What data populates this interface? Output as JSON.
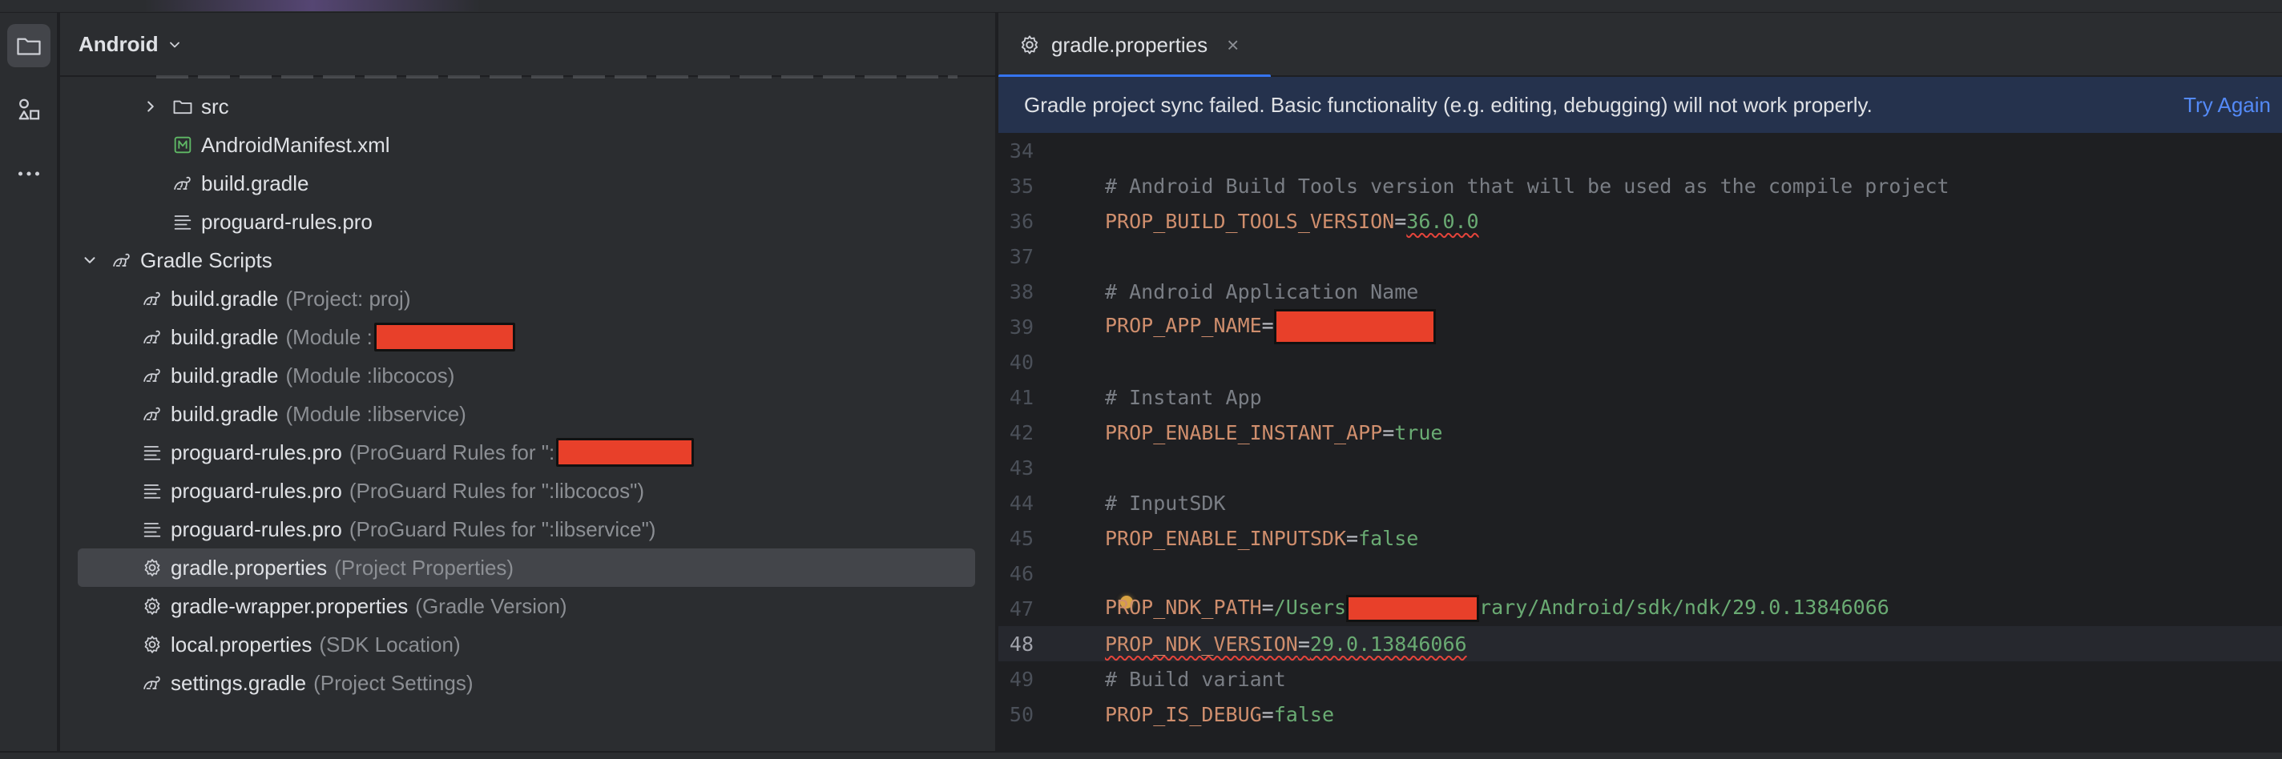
{
  "project_panel": {
    "title": "Android",
    "tree": [
      {
        "label": "src",
        "hint": "",
        "icon": "folder-icon"
      },
      {
        "label": "AndroidManifest.xml",
        "hint": "",
        "icon": "manifest-icon"
      },
      {
        "label": "build.gradle",
        "hint": "",
        "icon": "gradle-icon"
      },
      {
        "label": "proguard-rules.pro",
        "hint": "",
        "icon": "text-file-icon"
      },
      {
        "label": "Gradle Scripts",
        "hint": "",
        "icon": "gradle-icon"
      },
      {
        "label": "build.gradle",
        "hint": "(Project: proj)",
        "icon": "gradle-icon"
      },
      {
        "label": "build.gradle",
        "hint": "(Module :",
        "icon": "gradle-icon"
      },
      {
        "label": "build.gradle",
        "hint": "(Module :libcocos)",
        "icon": "gradle-icon"
      },
      {
        "label": "build.gradle",
        "hint": "(Module :libservice)",
        "icon": "gradle-icon"
      },
      {
        "label": "proguard-rules.pro",
        "hint": "(ProGuard Rules for \":",
        "icon": "text-file-icon"
      },
      {
        "label": "proguard-rules.pro",
        "hint": "(ProGuard Rules for \":libcocos\")",
        "icon": "text-file-icon"
      },
      {
        "label": "proguard-rules.pro",
        "hint": "(ProGuard Rules for \":libservice\")",
        "icon": "text-file-icon"
      },
      {
        "label": "gradle.properties",
        "hint": "(Project Properties)",
        "icon": "gear-icon"
      },
      {
        "label": "gradle-wrapper.properties",
        "hint": "(Gradle Version)",
        "icon": "gear-icon"
      },
      {
        "label": "local.properties",
        "hint": "(SDK Location)",
        "icon": "gear-icon"
      },
      {
        "label": "settings.gradle",
        "hint": "(Project Settings)",
        "icon": "gradle-icon"
      }
    ]
  },
  "editor": {
    "tab": {
      "label": "gradle.properties",
      "close": "×"
    },
    "banner": {
      "message": "Gradle project sync failed. Basic functionality (e.g. editing, debugging) will not work properly.",
      "action": "Try Again"
    },
    "lines": [
      {
        "num": "34",
        "comment": "",
        "key": "",
        "eq": "",
        "value": ""
      },
      {
        "num": "35",
        "comment": "# Android Build Tools version that will be used as the compile project",
        "key": "",
        "eq": "",
        "value": ""
      },
      {
        "num": "36",
        "comment": "",
        "key": "PROP_BUILD_TOOLS_VERSION",
        "eq": "=",
        "value": "36.0.0"
      },
      {
        "num": "37",
        "comment": "",
        "key": "",
        "eq": "",
        "value": ""
      },
      {
        "num": "38",
        "comment": "# Android Application Name",
        "key": "",
        "eq": "",
        "value": ""
      },
      {
        "num": "39",
        "comment": "",
        "key": "PROP_APP_NAME",
        "eq": "=",
        "value": ""
      },
      {
        "num": "40",
        "comment": "",
        "key": "",
        "eq": "",
        "value": ""
      },
      {
        "num": "41",
        "comment": "# Instant App",
        "key": "",
        "eq": "",
        "value": ""
      },
      {
        "num": "42",
        "comment": "",
        "key": "PROP_ENABLE_INSTANT_APP",
        "eq": "=",
        "value": "true"
      },
      {
        "num": "43",
        "comment": "",
        "key": "",
        "eq": "",
        "value": ""
      },
      {
        "num": "44",
        "comment": "# InputSDK",
        "key": "",
        "eq": "",
        "value": ""
      },
      {
        "num": "45",
        "comment": "",
        "key": "PROP_ENABLE_INPUTSDK",
        "eq": "=",
        "value": "false"
      },
      {
        "num": "46",
        "comment": "",
        "key": "",
        "eq": "",
        "value": ""
      },
      {
        "num": "47",
        "comment": "",
        "key": "PROP_NDK_PATH",
        "eq": "=",
        "value": "/Users",
        "value_after": "rary/Android/sdk/ndk/29.0.13846066"
      },
      {
        "num": "48",
        "comment": "",
        "key": "PROP_NDK_VERSION",
        "eq": "=",
        "value": "29.0.13846066"
      },
      {
        "num": "49",
        "comment": "# Build variant",
        "key": "",
        "eq": "",
        "value": ""
      },
      {
        "num": "50",
        "comment": "",
        "key": "PROP_IS_DEBUG",
        "eq": "=",
        "value": "false"
      }
    ]
  },
  "colors": {
    "accent": "#3574f0",
    "link": "#548af7",
    "comment": "#7a7e85",
    "key": "#cf8e6d",
    "value": "#6aab73",
    "redaction": "#e8402a"
  }
}
